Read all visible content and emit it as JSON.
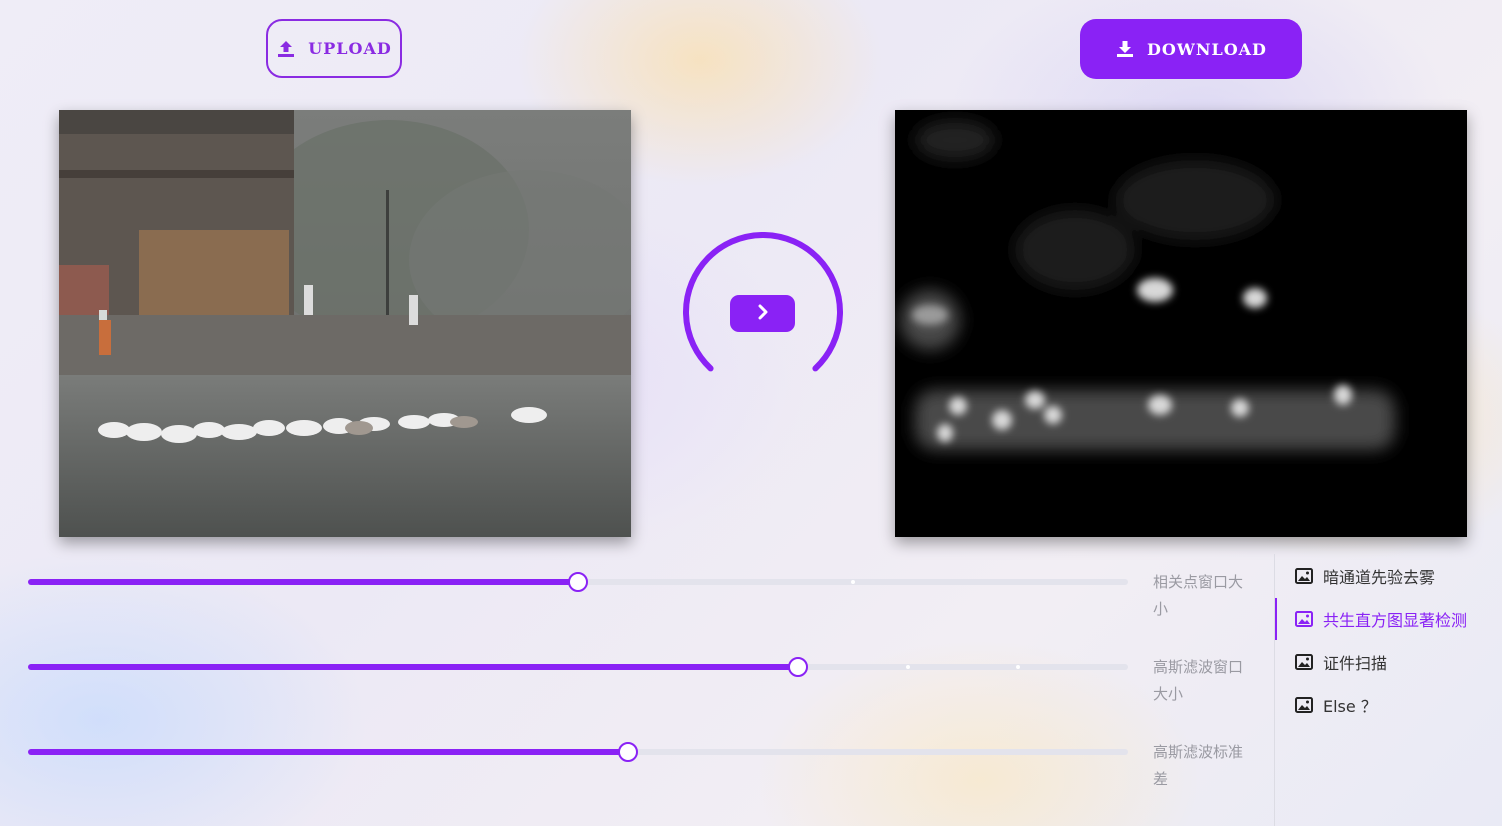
{
  "toolbar": {
    "upload_label": "UPLOAD",
    "download_label": "DOWNLOAD",
    "upload_icon": "upload-icon",
    "download_icon": "download-icon"
  },
  "process": {
    "icon": "chevron-right-icon"
  },
  "sliders": [
    {
      "label": "相关点窗口大小",
      "fill_fraction": 0.5,
      "tick_fractions": [
        0.75
      ]
    },
    {
      "label": "高斯滤波窗口大小",
      "fill_fraction": 0.7,
      "tick_fractions": [
        0.8,
        0.9
      ]
    },
    {
      "label": "高斯滤波标准差",
      "fill_fraction": 0.545,
      "tick_fractions": []
    }
  ],
  "menu": {
    "items": [
      {
        "label": "暗通道先验去雾",
        "icon": "image-icon",
        "active": false
      },
      {
        "label": "共生直方图显著检测",
        "icon": "image-icon",
        "active": true
      },
      {
        "label": "证件扫描",
        "icon": "image-icon",
        "active": false
      },
      {
        "label": "Else ？",
        "icon": "image-icon",
        "active": false
      }
    ]
  },
  "colors": {
    "accent": "#8a22f5",
    "track": "#e3e3ec",
    "label": "#9a9aa2"
  }
}
